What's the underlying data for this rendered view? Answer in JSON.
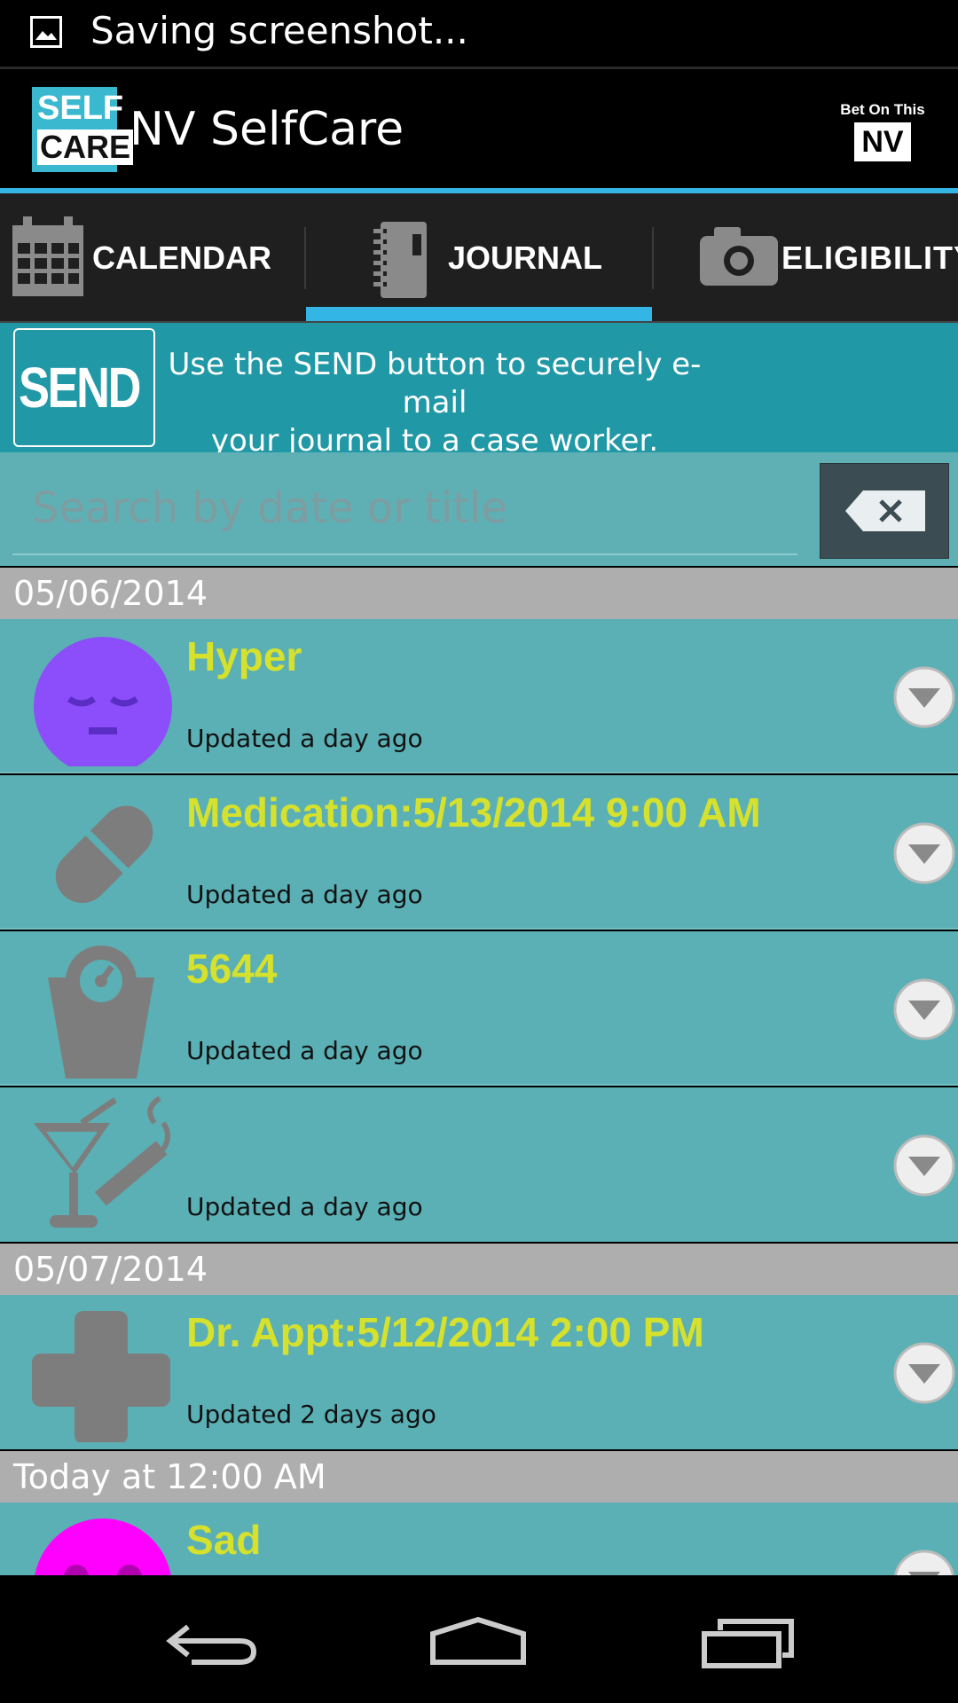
{
  "status_bar": {
    "notification": "Saving screenshot..."
  },
  "action_bar": {
    "logo_line1": "SELF",
    "logo_line2": "CARE",
    "title": "NV SelfCare",
    "badge_top": "Bet On This",
    "badge_mark": "NV"
  },
  "tabs": [
    {
      "label": "CALENDAR",
      "icon": "calendar-icon",
      "selected": false
    },
    {
      "label": "JOURNAL",
      "icon": "journal-icon",
      "selected": true
    },
    {
      "label": "ELIGIBILITY",
      "icon": "camera-icon",
      "selected": false
    }
  ],
  "banner": {
    "send_label": "SEND",
    "text_line1": "Use the SEND button to securely e-mail",
    "text_line2": "your journal to a case worker."
  },
  "search": {
    "placeholder": "Search by date or title",
    "value": ""
  },
  "groups": [
    {
      "date": "05/06/2014",
      "entries": [
        {
          "title": "Hyper",
          "updated": "Updated a day ago",
          "icon": "mood-face-icon"
        },
        {
          "title": "Medication:5/13/2014 9:00 AM",
          "updated": "Updated a day ago",
          "icon": "pill-icon"
        },
        {
          "title": "5644",
          "updated": "Updated a day ago",
          "icon": "weight-scale-icon"
        },
        {
          "title": "",
          "updated": "Updated a day ago",
          "icon": "cocktail-cigarette-icon"
        }
      ]
    },
    {
      "date": "05/07/2014",
      "entries": [
        {
          "title": "Dr. Appt:5/12/2014 2:00 PM",
          "updated": "Updated 2 days ago",
          "icon": "medical-cross-icon"
        }
      ]
    },
    {
      "date": "Today at 12:00 AM",
      "entries": [
        {
          "title": "Sad",
          "updated": "",
          "icon": "sad-face-icon"
        }
      ]
    }
  ],
  "colors": {
    "accent": "#33b5e5",
    "banner": "#2198a6",
    "list_bg": "#5bb0b5",
    "title_text": "#d5e12c",
    "header_bg": "#aeaeae",
    "hyper_face": "#8c4dfa",
    "sad_face": "#ff00ff"
  }
}
